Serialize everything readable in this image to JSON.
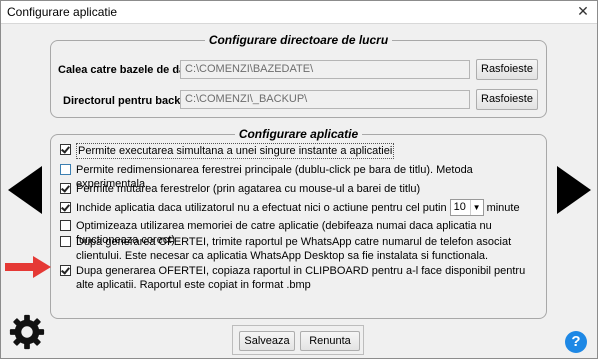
{
  "window": {
    "title": "Configurare aplicatie",
    "close_glyph": "✕"
  },
  "directories": {
    "legend": "Configurare directoare de lucru",
    "db_label": "Calea catre bazele de date:",
    "db_path": "C:\\COMENZI\\BAZEDATE\\",
    "backup_label": "Directorul pentru backup:",
    "backup_path": "C:\\COMENZI\\_BACKUP\\",
    "browse_label": "Rasfoieste"
  },
  "options": {
    "legend": "Configurare aplicatie",
    "items": [
      {
        "text": "Permite executarea simultana a unei singure instante a aplicatiei",
        "checked": true
      },
      {
        "text": "Permite redimensionarea ferestrei principale (dublu-click pe bara de titlu). Metoda experimentala.",
        "checked": false
      },
      {
        "text": "Permite mutarea ferestrelor (prin agatarea cu mouse-ul a barei de titlu)",
        "checked": true
      },
      {
        "text_before": "Inchide aplicatia daca utilizatorul nu a efectuat nici o actiune pentru cel putin",
        "timeout_value": "10",
        "text_after": "minute",
        "checked": true
      },
      {
        "text": "Optimizeaza utilizarea memoriei de catre aplicatie (debifeaza numai daca aplicatia nu functioneaza corect)",
        "checked": false
      },
      {
        "text": "Dupa generarea OFERTEI, trimite raportul pe WhatsApp catre numarul de telefon asociat clientului.  Este necesar ca aplicatia WhatsApp Desktop sa fie instalata si functionala.",
        "checked": false
      },
      {
        "text": "Dupa generarea OFERTEI, copiaza raportul in CLIPBOARD pentru a-l face disponibil pentru alte aplicatii. Raportul este copiat in format .bmp",
        "checked": true
      }
    ]
  },
  "buttons": {
    "save": "Salveaza",
    "cancel": "Renunta"
  },
  "help_glyph": "?",
  "colors": {
    "accent_red": "#e53935",
    "help_blue": "#1e88e5"
  }
}
